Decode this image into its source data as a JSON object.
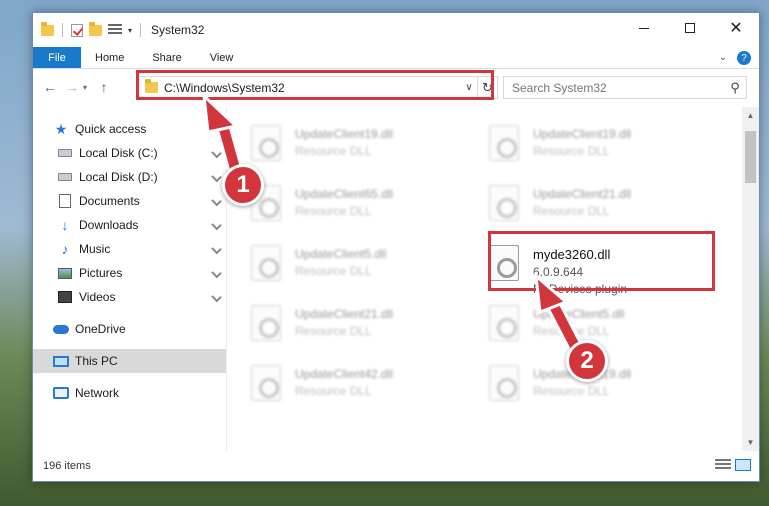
{
  "window": {
    "title": "System32",
    "controls": {
      "minimize": "–",
      "maximize": "☐",
      "close": "✕"
    }
  },
  "ribbon": {
    "file": "File",
    "tabs": [
      "Home",
      "Share",
      "View"
    ],
    "expand_icon": "chevron-down-icon",
    "help": "?"
  },
  "nav": {
    "back": "←",
    "forward": "→",
    "dropdown": "▾",
    "up": "↑",
    "address": "C:\\Windows\\System32",
    "address_dd": "∨",
    "refresh": "↻",
    "search_placeholder": "Search System32",
    "search_icon": "⚲"
  },
  "sidebar": {
    "quick_access": "Quick access",
    "items": [
      {
        "label": "Local Disk (C:)",
        "icon": "disk-icon"
      },
      {
        "label": "Local Disk (D:)",
        "icon": "disk-icon"
      },
      {
        "label": "Documents",
        "icon": "documents-icon"
      },
      {
        "label": "Downloads",
        "icon": "downloads-icon"
      },
      {
        "label": "Music",
        "icon": "music-icon"
      },
      {
        "label": "Pictures",
        "icon": "pictures-icon"
      },
      {
        "label": "Videos",
        "icon": "videos-icon"
      }
    ],
    "onedrive": "OneDrive",
    "this_pc": "This PC",
    "network": "Network"
  },
  "files": [
    {
      "name": "UpdateClient19.dll",
      "desc": "Resource DLL"
    },
    {
      "name": "UpdateClient19.dll",
      "desc": "Resource DLL"
    },
    {
      "name": "UpdateClient65.dll",
      "desc": "Resource DLL"
    },
    {
      "name": "UpdateClient21.dll",
      "desc": "Resource DLL"
    },
    {
      "name": "UpdateClient5.dll",
      "desc": "Resource DLL"
    },
    {
      "name": "myde3260.dll",
      "desc": "6.0.9.644",
      "desc2": "MyDevices plugin"
    },
    {
      "name": "UpdateClient21.dll",
      "desc": "Resource DLL"
    },
    {
      "name": "UpdateClient5.dll",
      "desc": "Resource DLL"
    },
    {
      "name": "UpdateClient42.dll",
      "desc": "Resource DLL"
    },
    {
      "name": "UpdateClient19.dll",
      "desc": "Resource DLL"
    }
  ],
  "status": {
    "count": "196 items"
  },
  "callouts": {
    "one": "1",
    "two": "2"
  },
  "colors": {
    "accent": "#1979ca",
    "highlight": "#d2363c"
  }
}
